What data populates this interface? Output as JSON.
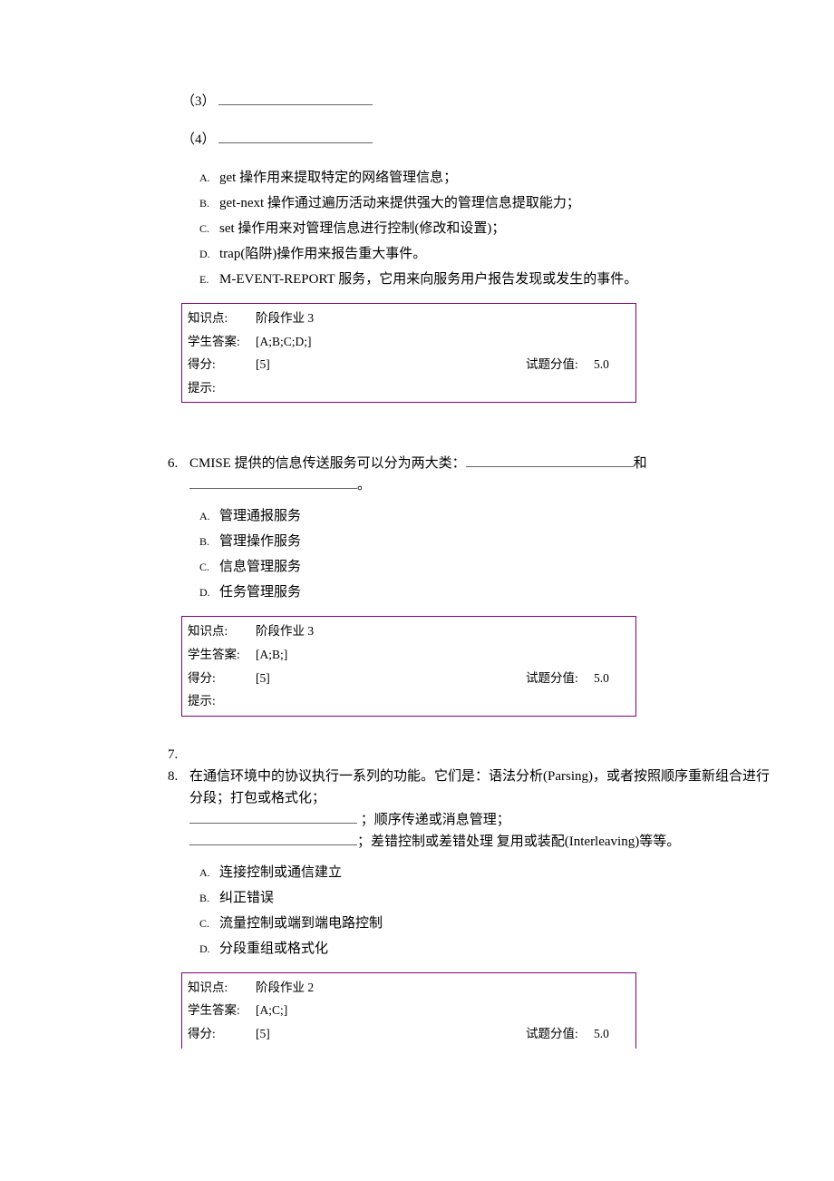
{
  "q5": {
    "fill3_label": "（3）",
    "fill4_label": "（4）",
    "options": [
      {
        "letter": "A.",
        "text": "get 操作用来提取特定的网络管理信息；"
      },
      {
        "letter": "B.",
        "text": "get-next 操作通过遍历活动来提供强大的管理信息提取能力；"
      },
      {
        "letter": "C.",
        "text": "set 操作用来对管理信息进行控制(修改和设置)；"
      },
      {
        "letter": "D.",
        "text": "trap(陷阱)操作用来报告重大事件。"
      },
      {
        "letter": "E.",
        "text": "M-EVENT-REPORT 服务，它用来向服务用户报告发现或发生的事件。"
      }
    ],
    "box": {
      "kplabel": "知识点:",
      "kp": "阶段作业 3",
      "anslabel": "学生答案:",
      "ans": "[A;B;C;D;]",
      "scorelabel": "得分:",
      "score": "[5]",
      "vallabel": "试题分值:",
      "val": "5.0",
      "hintlabel": "提示:",
      "hint": ""
    }
  },
  "q6": {
    "num": "6.",
    "text_pre": "CMISE 提供的信息传送服务可以分为两大类：",
    "text_mid": "和",
    "text_end": "。",
    "options": [
      {
        "letter": "A.",
        "text": "管理通报服务"
      },
      {
        "letter": "B.",
        "text": "管理操作服务"
      },
      {
        "letter": "C.",
        "text": "信息管理服务"
      },
      {
        "letter": "D.",
        "text": "任务管理服务"
      }
    ],
    "box": {
      "kplabel": "知识点:",
      "kp": "阶段作业 3",
      "anslabel": "学生答案:",
      "ans": "[A;B;]",
      "scorelabel": "得分:",
      "score": "[5]",
      "vallabel": "试题分值:",
      "val": "5.0",
      "hintlabel": "提示:",
      "hint": ""
    }
  },
  "q7": {
    "num": "7."
  },
  "q8": {
    "num": "8.",
    "line1": "在通信环境中的协议执行一系列的功能。它们是：语法分析(Parsing)，或者按照顺序重新组合进行分段；打包或格式化；",
    "seg2a": " ；顺序传递或消息管理；",
    "seg3a": "；差错控制或差错处理 复用或装配(Interleaving)等等。",
    "options": [
      {
        "letter": "A.",
        "text": "连接控制或通信建立"
      },
      {
        "letter": "B.",
        "text": "纠正错误"
      },
      {
        "letter": "C.",
        "text": "流量控制或端到端电路控制"
      },
      {
        "letter": "D.",
        "text": "分段重组或格式化"
      }
    ],
    "box": {
      "kplabel": "知识点:",
      "kp": "阶段作业 2",
      "anslabel": "学生答案:",
      "ans": "[A;C;]",
      "scorelabel": "得分:",
      "score": "[5]",
      "vallabel": "试题分值:",
      "val": "5.0"
    }
  }
}
